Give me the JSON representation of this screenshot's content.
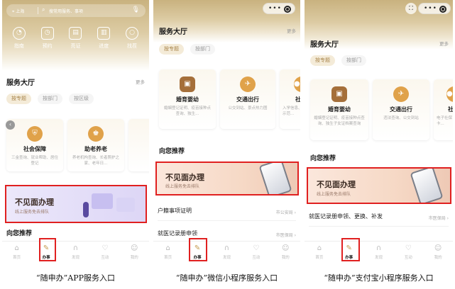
{
  "colors": {
    "accent": "#c59b4f",
    "highlight": "#e02020",
    "header": "#c9b27f"
  },
  "app": {
    "location": "上海",
    "search_placeholder": "搜常用服务、事项",
    "quick": [
      {
        "label": "指南",
        "icon": "compass-icon",
        "glyph": "◔"
      },
      {
        "label": "预约",
        "icon": "calendar-icon",
        "glyph": "◷"
      },
      {
        "label": "亮证",
        "icon": "card-icon",
        "glyph": "▤"
      },
      {
        "label": "进度",
        "icon": "chart-icon",
        "glyph": "▥"
      },
      {
        "label": "找茬",
        "icon": "search-icon",
        "glyph": "○"
      }
    ],
    "hall_title": "服务大厅",
    "more": "更多",
    "chips": [
      "按专题",
      "按部门",
      "按区级"
    ],
    "cards": [
      {
        "title": "社会保障",
        "desc": "三金查询、就业帮助、居住登记"
      },
      {
        "title": "助老养老",
        "desc": "养老机构查询、长者照护之家、老年日..."
      },
      {
        "title": "",
        "desc": ""
      }
    ],
    "banner_title": "不见面办理",
    "banner_sub": "线上服务免去排队",
    "recommend": "向您推荐",
    "caption": "“随申办”APP服务入口"
  },
  "wechat": {
    "hall_title": "服务大厅",
    "more": "更多",
    "chips": [
      "按专题",
      "按部门"
    ],
    "cards": [
      {
        "title": "婚育婴幼",
        "desc": "婚姻登记证明、疫苗接种点查询、独生..."
      },
      {
        "title": "交通出行",
        "desc": "公交到站、景点热力图"
      },
      {
        "title": "社",
        "desc": "入学信息、示范..."
      }
    ],
    "recommend": "向您推荐",
    "banner_title": "不见面办理",
    "banner_sub": "线上服务免去排队",
    "rows": [
      {
        "title": "户籍事项证明",
        "right": "市公安局 ›"
      },
      {
        "title": "就医记录册申领",
        "right": "市医保局 ›"
      }
    ],
    "caption": "“随申办”微信小程序服务入口"
  },
  "alipay": {
    "hall_title": "服务大厅",
    "more": "更多",
    "chips": [
      "按专题",
      "按部门"
    ],
    "cards": [
      {
        "title": "婚育婴幼",
        "desc": "婚姻登记证明、疫苗接种点查询、独生子女证档案查询"
      },
      {
        "title": "交通出行",
        "desc": "违法查询、公交到站"
      },
      {
        "title": "社",
        "desc": "电子社保卡..."
      }
    ],
    "recommend": "向您推荐",
    "banner_title": "不见面办理",
    "banner_sub": "线上服务免去排队",
    "rows": [
      {
        "title": "就医记录册申领、更换、补发",
        "right": "市医保局 ›"
      }
    ],
    "caption": "“随申办”支付宝小程序服务入口"
  },
  "tabs": [
    {
      "label": "首页",
      "icon": "home-icon",
      "glyph": "⌂"
    },
    {
      "label": "办事",
      "icon": "brush-icon",
      "glyph": "✎"
    },
    {
      "label": "发现",
      "icon": "arch-icon",
      "glyph": "∩"
    },
    {
      "label": "互动",
      "icon": "heart-icon",
      "glyph": "♡"
    },
    {
      "label": "我的",
      "icon": "user-icon",
      "glyph": "☺"
    }
  ]
}
